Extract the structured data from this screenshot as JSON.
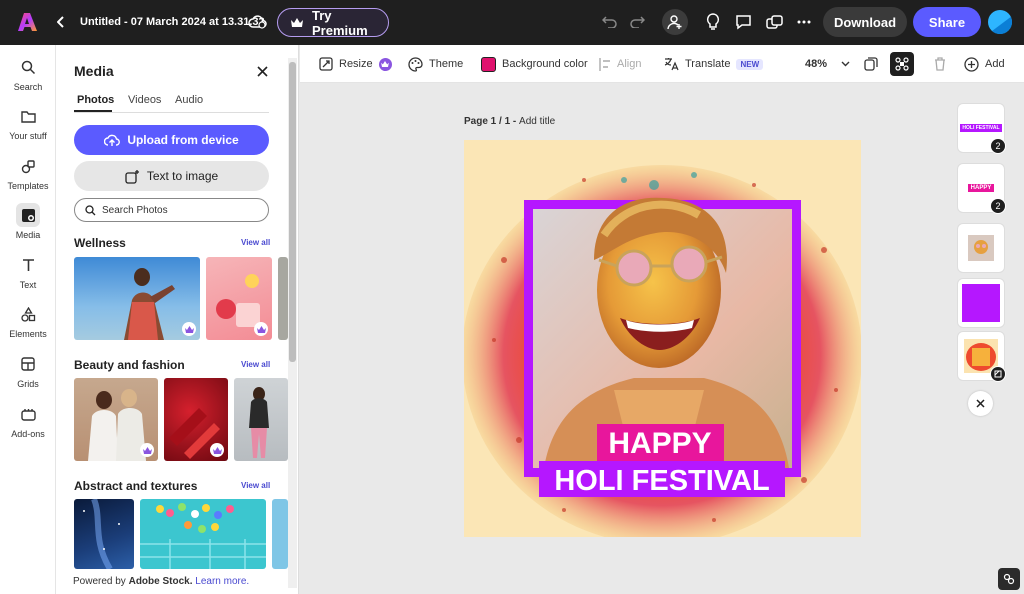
{
  "topbar": {
    "doc_title": "Untitled - 07 March 2024 at 13.31.32",
    "premium_label": "Try Premium",
    "download_label": "Download",
    "share_label": "Share"
  },
  "rail": {
    "items": [
      {
        "label": "Search",
        "icon": "search-icon"
      },
      {
        "label": "Your stuff",
        "icon": "folder-icon"
      },
      {
        "label": "Templates",
        "icon": "templates-icon"
      },
      {
        "label": "Media",
        "icon": "media-icon"
      },
      {
        "label": "Text",
        "icon": "text-icon"
      },
      {
        "label": "Elements",
        "icon": "elements-icon"
      },
      {
        "label": "Grids",
        "icon": "grids-icon"
      },
      {
        "label": "Add-ons",
        "icon": "addons-icon"
      }
    ]
  },
  "panel": {
    "title": "Media",
    "tabs": [
      "Photos",
      "Videos",
      "Audio"
    ],
    "upload_label": "Upload from device",
    "text_to_image_label": "Text to image",
    "search_placeholder": "Search Photos",
    "sections": [
      {
        "title": "Wellness",
        "view_all": "View all"
      },
      {
        "title": "Beauty and fashion",
        "view_all": "View all"
      },
      {
        "title": "Abstract and textures",
        "view_all": "View all"
      }
    ],
    "footer_prefix": "Powered by ",
    "footer_brand": "Adobe Stock.",
    "footer_link": "Learn more."
  },
  "toolbar": {
    "resize": "Resize",
    "theme": "Theme",
    "background_color": "Background color",
    "align": "Align",
    "translate": "Translate",
    "new_badge": "NEW",
    "zoom": "48%",
    "add": "Add"
  },
  "canvas": {
    "page_label": "Page 1 / 1 - ",
    "add_title": "Add title",
    "headline1": "HAPPY",
    "headline2": "HOLI FESTIVAL"
  },
  "pages": {
    "thumb1_text": "HOLI FESTIVAL",
    "thumb1_count": "2",
    "thumb2_text": "HAPPY",
    "thumb2_count": "2"
  },
  "colors": {
    "accent": "#5b5bff",
    "frame": "#b517ff",
    "headline_bg": "#e8169c",
    "background_swatch": "#e0126e"
  }
}
